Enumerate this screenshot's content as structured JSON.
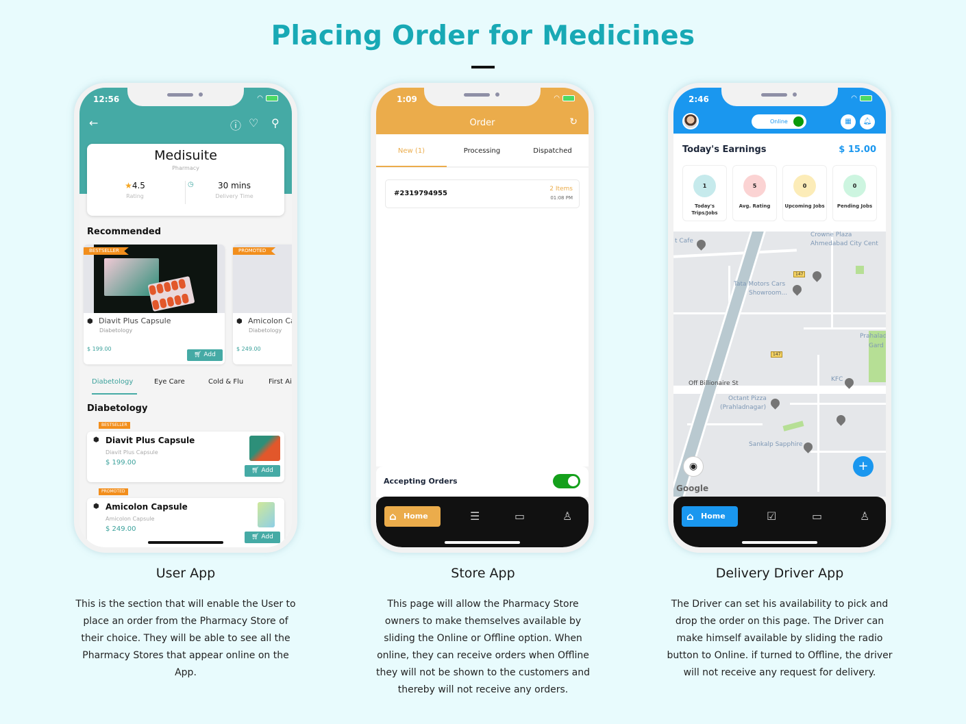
{
  "page": {
    "title": "Placing Order for Medicines"
  },
  "user_app": {
    "status_time": "12:56",
    "store": {
      "name": "Medisuite",
      "type": "Pharmacy",
      "rating": "4.5",
      "rating_label": "Rating",
      "delivery_time": "30 mins",
      "delivery_label": "Delivery Time"
    },
    "recommended_title": "Recommended",
    "recommended": [
      {
        "badge": "BESTSELLER",
        "name": "Diavit Plus Capsule",
        "category": "Diabetology",
        "price": "$ 199.00",
        "add_label": "Add"
      },
      {
        "badge": "PROMOTED",
        "name": "Amicolon Capsule",
        "category": "Diabetology",
        "price": "$ 249.00"
      }
    ],
    "categories": [
      "Diabetology",
      "Eye Care",
      "Cold & Flu",
      "First Aid"
    ],
    "active_category": "Diabetology",
    "section_title": "Diabetology",
    "products": [
      {
        "badge": "BESTSELLER",
        "name": "Diavit Plus Capsule",
        "subtitle": "Diavit Plus Capsule",
        "price": "$ 199.00",
        "add_label": "Add"
      },
      {
        "badge": "PROMOTED",
        "name": "Amicolon Capsule",
        "subtitle": "Amicolon Capsule",
        "price": "$ 249.00",
        "add_label": "Add"
      }
    ],
    "caption": "User App",
    "description": "This is the section that will enable the User to place an order from the Pharmacy Store of their choice. They will be able to see all the Pharmacy Stores that appear online on the App."
  },
  "store_app": {
    "status_time": "1:09",
    "header_title": "Order",
    "tabs": [
      "New (1)",
      "Processing",
      "Dispatched"
    ],
    "active_tab": "New (1)",
    "order": {
      "id": "#2319794955",
      "items": "2 Items",
      "time": "01:08 PM"
    },
    "accepting_label": "Accepting Orders",
    "accepting_on": true,
    "nav": {
      "home": "Home"
    },
    "caption": "Store App",
    "description": "This page will allow the Pharmacy Store owners to make themselves available by sliding the Online or Offline option. When online, they can receive orders when Offline they will not be shown to the customers and thereby will not receive any orders."
  },
  "driver_app": {
    "status_time": "2:46",
    "online_label": "Online",
    "earnings_title": "Today's Earnings",
    "earnings_value": "$ 15.00",
    "stats": [
      {
        "value": "1",
        "label": "Today's Trips/Jobs",
        "color": "#c6eaec"
      },
      {
        "value": "5",
        "label": "Avg. Rating",
        "color": "#fbd3d3"
      },
      {
        "value": "0",
        "label": "Upcoming Jobs",
        "color": "#fcecb8"
      },
      {
        "value": "0",
        "label": "Pending Jobs",
        "color": "#cdf5e0"
      }
    ],
    "map_labels": {
      "cafe": "t Cafe",
      "crowne": "Crowne Plaza",
      "crowne2": "Ahmedabad City Cent",
      "tata": "Tata Motors Cars",
      "tata2": "Showroom...",
      "prahalad": "Prahalad",
      "prahalad2": "Gard",
      "billionaire": "Off Billionaire St",
      "kfc": "KFC",
      "octant": "Octant Pizza",
      "octant2": "(Prahladnagar)",
      "sankalp": "Sankalp Sapphire",
      "route1": "147",
      "route2": "147",
      "google": "Google"
    },
    "nav": {
      "home": "Home"
    },
    "caption": "Delivery Driver App",
    "description": "The Driver can set his availability to pick and drop the order on this page. The Driver can make himself available by sliding the radio button to Online. if turned to Offline, the driver will not receive any request for delivery."
  },
  "colors": {
    "title": "#18a9b5",
    "user_primary": "#45aaa5",
    "store_primary": "#ebac4b",
    "driver_primary": "#1a97ef"
  }
}
